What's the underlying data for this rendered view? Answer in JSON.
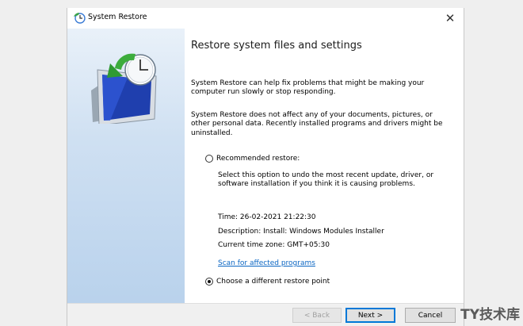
{
  "window": {
    "title": "System Restore",
    "close_label": "✕"
  },
  "main": {
    "heading": "Restore system files and settings",
    "intro": "System Restore can help fix problems that might be making your computer run slowly or stop responding.",
    "note": "System Restore does not affect any of your documents, pictures, or other personal data. Recently installed programs and drivers might be uninstalled.",
    "recommended": {
      "label": "Recommended restore:",
      "description": "Select this option to undo the most recent update, driver, or software installation if you think it is causing problems.",
      "time": "Time: 26-02-2021 21:22:30",
      "desc_line": "Description: Install: Windows Modules Installer",
      "timezone": "Current time zone: GMT+05:30",
      "scan_link": "Scan for affected programs",
      "selected": false
    },
    "different": {
      "label": "Choose a different restore point",
      "selected": true
    }
  },
  "footer": {
    "back": "< Back",
    "next": "Next >",
    "cancel": "Cancel"
  },
  "watermark": "TY技术库",
  "colors": {
    "link": "#0b66c3",
    "accent": "#0078d7"
  }
}
